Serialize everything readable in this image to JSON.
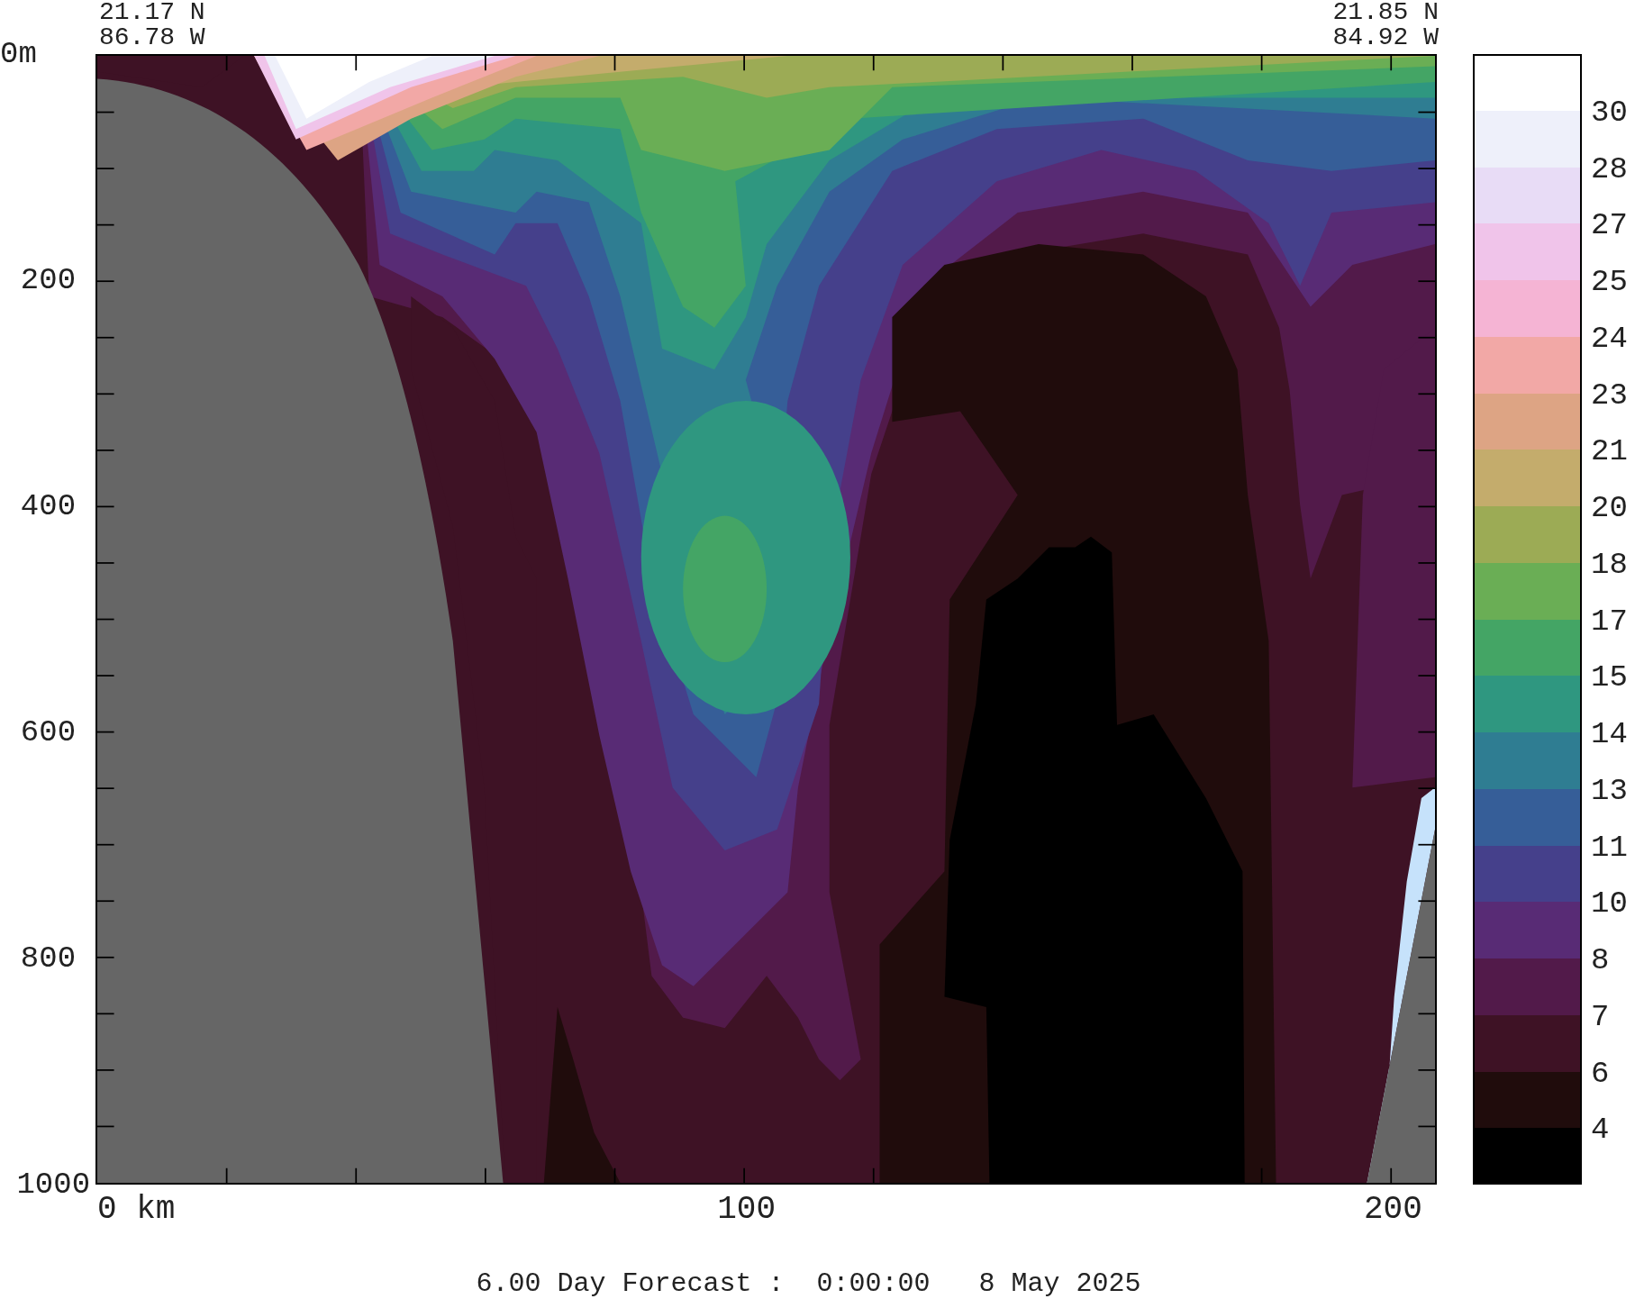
{
  "header": {
    "left": {
      "lat": "21.17 N",
      "lon": "86.78 W"
    },
    "right": {
      "lat": "21.85 N",
      "lon": "84.92 W"
    }
  },
  "y_axis": {
    "labels": [
      "0m",
      "200",
      "400",
      "600",
      "800",
      "1000"
    ]
  },
  "x_axis": {
    "labels": [
      "0 km",
      "100",
      "200"
    ]
  },
  "colorbar": {
    "bands": [
      {
        "color": "#ffffff",
        "label": "30"
      },
      {
        "color": "#eef0fa",
        "label": "28"
      },
      {
        "color": "#e8dcf6",
        "label": "27"
      },
      {
        "color": "#f0c4ea",
        "label": "25"
      },
      {
        "color": "#f5b4d4",
        "label": "24"
      },
      {
        "color": "#f2a8a6",
        "label": "23"
      },
      {
        "color": "#dda484",
        "label": "21"
      },
      {
        "color": "#c4ac6c",
        "label": "20"
      },
      {
        "color": "#9cab55",
        "label": "18"
      },
      {
        "color": "#6aae55",
        "label": "17"
      },
      {
        "color": "#44a565",
        "label": "15"
      },
      {
        "color": "#2f9780",
        "label": "14"
      },
      {
        "color": "#2f7d92",
        "label": "13"
      },
      {
        "color": "#365e98",
        "label": "11"
      },
      {
        "color": "#45408b",
        "label": "10"
      },
      {
        "color": "#582b75",
        "label": "8"
      },
      {
        "color": "#521a4a",
        "label": "7"
      },
      {
        "color": "#3e1225",
        "label": "6"
      },
      {
        "color": "#200c0c",
        "label": "4"
      },
      {
        "color": "#000000"
      }
    ]
  },
  "caption": "6.00 Day Forecast :  0:00:00   8 May 2025"
}
